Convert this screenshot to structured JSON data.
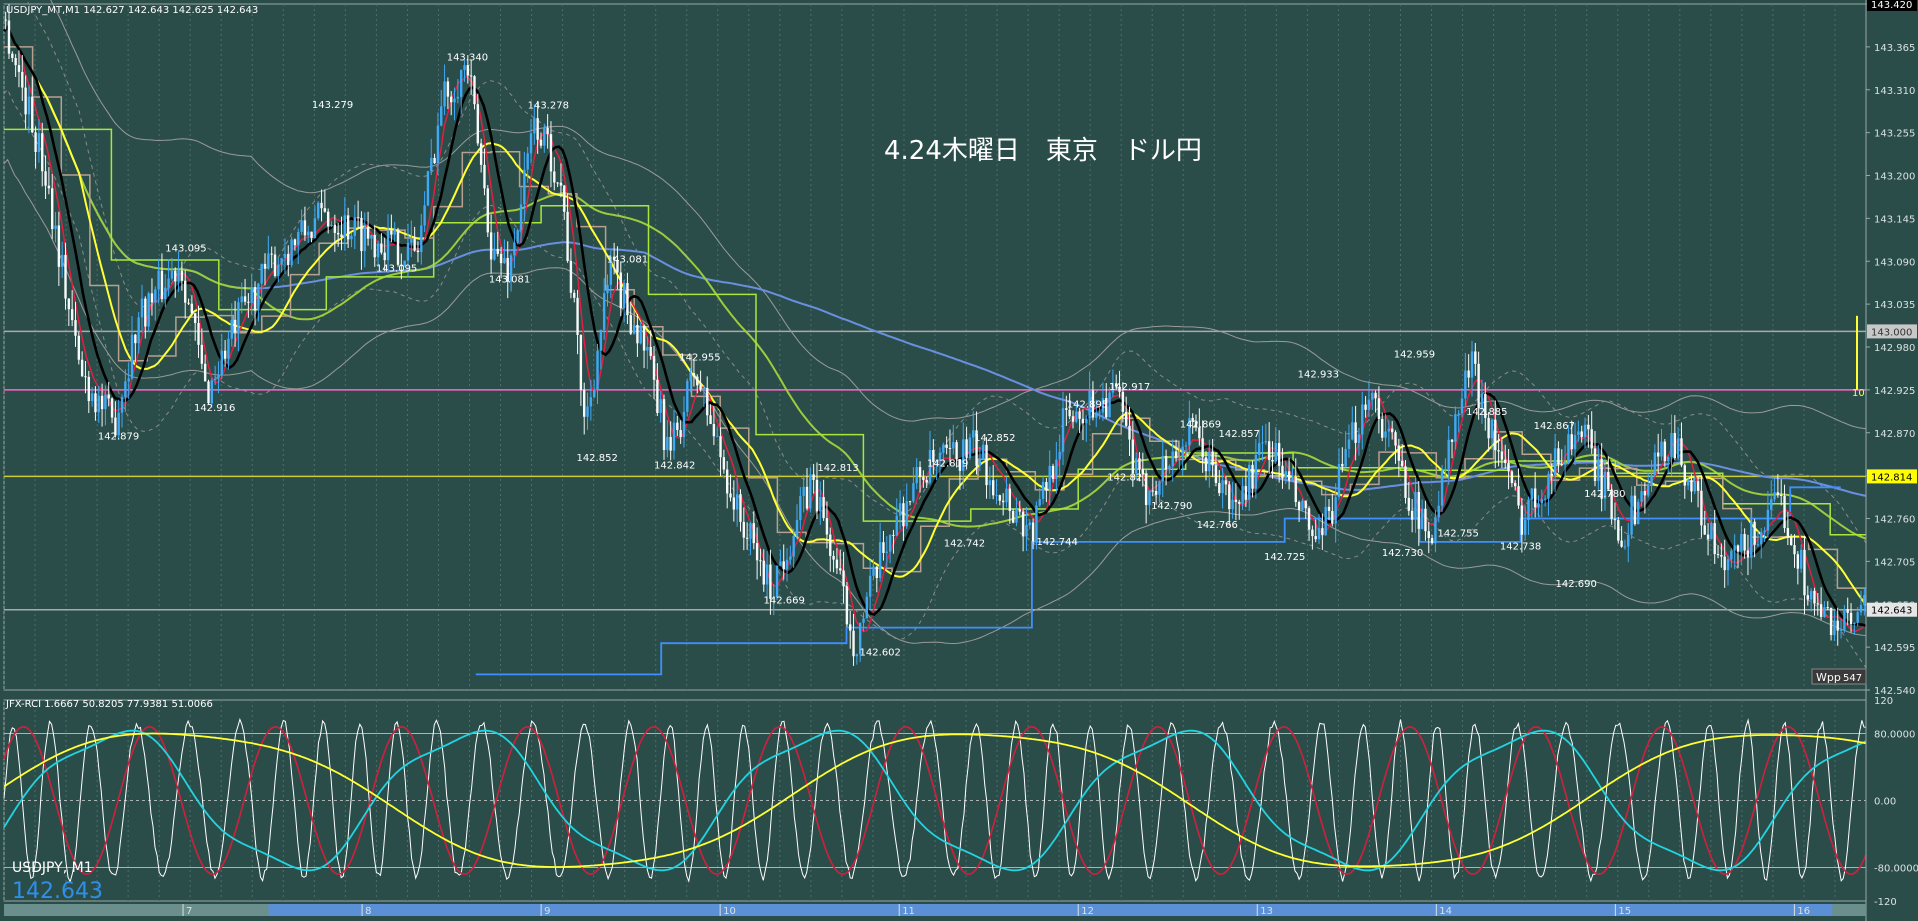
{
  "header": {
    "symbol_line": "USDJPY_MT,M1  142.627 142.643 142.625 142.643"
  },
  "annotation": "4.24木曜日　東京　ドル円",
  "indicator_header": "JFX-RCI 1.6667 50.8205 77.9381 51.0066",
  "bottom_left": {
    "symbol": "USDJPY, M1",
    "price": "142.643"
  },
  "price_tags": [
    {
      "text": "143.000",
      "value": 143.0,
      "bg": "#c8c8c8",
      "fg": "#333333"
    },
    {
      "text": "142.814",
      "value": 142.814,
      "bg": "#ffff00",
      "fg": "#000000"
    },
    {
      "text": "142.643",
      "value": 142.643,
      "bg": "#e6e6e6",
      "fg": "#000000"
    },
    {
      "text": "143.420",
      "value": 143.42,
      "bg": "#000000",
      "fg": "#ffffff"
    }
  ],
  "spread_label": "10",
  "wpp_label": "Wpp",
  "wpp_value": "547",
  "colors": {
    "background": "#2b4d4a",
    "candle_up": "#3fa9f5",
    "candle_down": "#f5fafa",
    "sma_black": "#000000",
    "ema_yellow": "#ffff33",
    "ema_red": "#e02040",
    "ma_green": "#9ccc3c",
    "ichimoku_lime": "#a8e63c",
    "ichimoku_tan": "#b8a090",
    "ma_blue": "#6a8fe0",
    "pink_line": "#ff66cc",
    "step_blue": "#3f8fff",
    "rci_white": "#ffffff",
    "rci_red": "#d0203c",
    "rci_cyan": "#22d3e0",
    "rci_yellow": "#ffff33"
  },
  "chart_data": {
    "type": "candlestick",
    "price_axis": {
      "range": [
        142.54,
        143.42
      ],
      "ticks": [
        "143.420",
        "143.365",
        "143.310",
        "143.255",
        "143.200",
        "143.145",
        "143.090",
        "143.035",
        "142.980",
        "142.925",
        "142.870",
        "142.815",
        "142.760",
        "142.705",
        "142.650",
        "142.595",
        "142.540"
      ]
    },
    "time_axis": {
      "labels": [
        {
          "text": "7",
          "slot": 0.5
        },
        {
          "text": "8",
          "slot": 1.5
        },
        {
          "text": "9",
          "slot": 2.5
        },
        {
          "text": "10",
          "slot": 3.5
        },
        {
          "text": "11",
          "slot": 4.5
        },
        {
          "text": "12",
          "slot": 5.5
        },
        {
          "text": "13",
          "slot": 6.5
        },
        {
          "text": "14",
          "slot": 7.5
        },
        {
          "text": "15",
          "slot": 8.5
        },
        {
          "text": "16",
          "slot": 9.5
        }
      ],
      "slot_count": 9.7
    },
    "horizontal_levels": [
      {
        "value": 143.0,
        "color": "#aaaaaa"
      },
      {
        "value": 142.925,
        "color": "#ff66cc"
      },
      {
        "value": 142.814,
        "color": "#cccc33"
      },
      {
        "value": 142.643,
        "color": "#aaaaaa"
      }
    ],
    "price_path": [
      [
        0,
        143.4
      ],
      [
        0.25,
        143.2
      ],
      [
        0.45,
        142.95
      ],
      [
        0.65,
        142.88
      ],
      [
        0.8,
        143.02
      ],
      [
        1.05,
        143.09
      ],
      [
        1.2,
        142.92
      ],
      [
        1.4,
        143.02
      ],
      [
        1.6,
        143.09
      ],
      [
        1.9,
        143.15
      ],
      [
        2.2,
        143.12
      ],
      [
        2.45,
        143.1
      ],
      [
        2.6,
        143.3
      ],
      [
        2.75,
        143.34
      ],
      [
        2.9,
        143.1
      ],
      [
        3.0,
        143.08
      ],
      [
        3.15,
        143.27
      ],
      [
        3.3,
        143.2
      ],
      [
        3.45,
        142.88
      ],
      [
        3.6,
        143.08
      ],
      [
        3.8,
        142.98
      ],
      [
        3.95,
        142.84
      ],
      [
        4.1,
        142.95
      ],
      [
        4.35,
        142.77
      ],
      [
        4.55,
        142.67
      ],
      [
        4.8,
        142.81
      ],
      [
        5.05,
        142.6
      ],
      [
        5.25,
        142.74
      ],
      [
        5.45,
        142.82
      ],
      [
        5.75,
        142.85
      ],
      [
        6.1,
        142.74
      ],
      [
        6.3,
        142.89
      ],
      [
        6.6,
        142.92
      ],
      [
        6.75,
        142.79
      ],
      [
        7.05,
        142.87
      ],
      [
        7.3,
        142.77
      ],
      [
        7.5,
        142.86
      ],
      [
        7.8,
        142.72
      ],
      [
        8.1,
        142.93
      ],
      [
        8.45,
        142.73
      ],
      [
        8.7,
        142.96
      ],
      [
        9.0,
        142.76
      ],
      [
        9.35,
        142.88
      ],
      [
        9.6,
        142.74
      ],
      [
        9.9,
        142.87
      ],
      [
        10.2,
        142.69
      ],
      [
        10.55,
        142.78
      ],
      [
        10.75,
        142.64
      ],
      [
        10.95,
        142.62
      ],
      [
        11.05,
        142.64
      ]
    ],
    "annotations": [
      {
        "t": 0.68,
        "v": 142.879,
        "text": "142.879",
        "pos": "below"
      },
      {
        "t": 1.08,
        "v": 143.095,
        "text": "143.095",
        "pos": "above"
      },
      {
        "t": 1.25,
        "v": 142.916,
        "text": "142.916",
        "pos": "below"
      },
      {
        "t": 1.95,
        "v": 143.279,
        "text": "143.279",
        "pos": "above"
      },
      {
        "t": 2.33,
        "v": 143.095,
        "text": "143.095",
        "pos": "below"
      },
      {
        "t": 2.75,
        "v": 143.34,
        "text": "143.340",
        "pos": "above"
      },
      {
        "t": 3.0,
        "v": 143.081,
        "text": "143.081",
        "pos": "below"
      },
      {
        "t": 3.23,
        "v": 143.278,
        "text": "143.278",
        "pos": "above"
      },
      {
        "t": 3.52,
        "v": 142.852,
        "text": "142.852",
        "pos": "below"
      },
      {
        "t": 3.7,
        "v": 143.081,
        "text": "143.081",
        "pos": "above"
      },
      {
        "t": 3.98,
        "v": 142.842,
        "text": "142.842",
        "pos": "below"
      },
      {
        "t": 4.13,
        "v": 142.955,
        "text": "142.955",
        "pos": "above"
      },
      {
        "t": 4.63,
        "v": 142.669,
        "text": "142.669",
        "pos": "below"
      },
      {
        "t": 4.95,
        "v": 142.813,
        "text": "142.813",
        "pos": "above"
      },
      {
        "t": 5.2,
        "v": 142.602,
        "text": "142.602",
        "pos": "below"
      },
      {
        "t": 5.6,
        "v": 142.819,
        "text": "142.819",
        "pos": "above"
      },
      {
        "t": 5.7,
        "v": 142.742,
        "text": "142.742",
        "pos": "below"
      },
      {
        "t": 5.88,
        "v": 142.852,
        "text": "142.852",
        "pos": "above"
      },
      {
        "t": 6.25,
        "v": 142.744,
        "text": "142.744",
        "pos": "below"
      },
      {
        "t": 6.43,
        "v": 142.895,
        "text": "142.895",
        "pos": "above"
      },
      {
        "t": 6.68,
        "v": 142.917,
        "text": "142.917",
        "pos": "above"
      },
      {
        "t": 6.67,
        "v": 142.827,
        "text": "142.827",
        "pos": "below"
      },
      {
        "t": 7.1,
        "v": 142.869,
        "text": "142.869",
        "pos": "above"
      },
      {
        "t": 6.93,
        "v": 142.79,
        "text": "142.790",
        "pos": "below"
      },
      {
        "t": 7.33,
        "v": 142.857,
        "text": "142.857",
        "pos": "above"
      },
      {
        "t": 7.2,
        "v": 142.766,
        "text": "142.766",
        "pos": "below"
      },
      {
        "t": 7.8,
        "v": 142.933,
        "text": "142.933",
        "pos": "above"
      },
      {
        "t": 7.6,
        "v": 142.725,
        "text": "142.725",
        "pos": "below"
      },
      {
        "t": 8.37,
        "v": 142.959,
        "text": "142.959",
        "pos": "above"
      },
      {
        "t": 8.3,
        "v": 142.73,
        "text": "142.730",
        "pos": "below"
      },
      {
        "t": 8.8,
        "v": 142.885,
        "text": "142.885",
        "pos": "above"
      },
      {
        "t": 8.63,
        "v": 142.755,
        "text": "142.755",
        "pos": "below"
      },
      {
        "t": 9.2,
        "v": 142.867,
        "text": "142.867",
        "pos": "above"
      },
      {
        "t": 9.0,
        "v": 142.738,
        "text": "142.738",
        "pos": "below"
      },
      {
        "t": 9.5,
        "v": 142.78,
        "text": "142.780",
        "pos": "above"
      },
      {
        "t": 9.33,
        "v": 142.69,
        "text": "142.690",
        "pos": "below"
      }
    ],
    "indicator": {
      "name": "JFX-RCI",
      "range": [
        -120,
        120
      ],
      "levels": [
        80,
        0,
        -80
      ],
      "tick_labels": [
        "120",
        "80.0000",
        "0.00",
        "-80.0000",
        "-120"
      ]
    }
  }
}
